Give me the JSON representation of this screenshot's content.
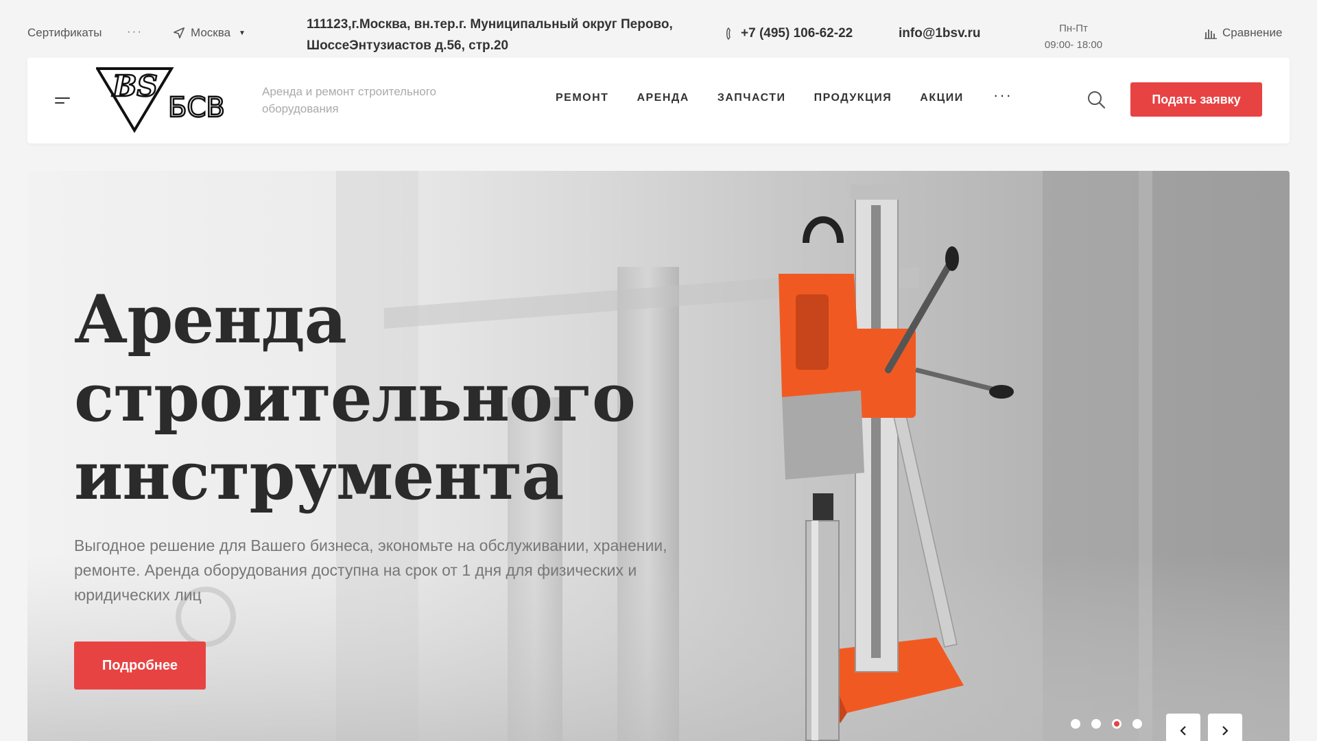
{
  "topbar": {
    "certificates": "Сертификаты",
    "more": "···",
    "city": "Москва",
    "address": "111123,г.Москва, вн.тер.г. Муниципальный округ Перово, ШоссеЭнтузиастов д.56, стр.20",
    "phone": "+7 (495) 106-62-22",
    "email": "info@1bsv.ru",
    "hours_days": "Пн-Пт",
    "hours_time": "09:00- 18:00",
    "compare": "Сравнение"
  },
  "header": {
    "logo_text": "БСВ",
    "logo_mark": "BS",
    "tagline": "Аренда и ремонт строительного оборудования",
    "nav": [
      "РЕМОНТ",
      "АРЕНДА",
      "ЗАПЧАСТИ",
      "ПРОДУКЦИЯ",
      "АКЦИИ"
    ],
    "nav_more": "···",
    "cta": "Подать заявку"
  },
  "hero": {
    "title": "Аренда строительного инструмента",
    "subtitle": "Выгодное решение для Вашего бизнеса, экономьте на обслуживании, хранении, ремонте. Аренда оборудования доступна на срок от 1 дня для физических и юридических лиц",
    "cta": "Подробнее",
    "slide_count": 4,
    "active_slide": 3
  },
  "colors": {
    "accent": "#e84343",
    "text": "#333333",
    "product_orange": "#f05a22"
  }
}
